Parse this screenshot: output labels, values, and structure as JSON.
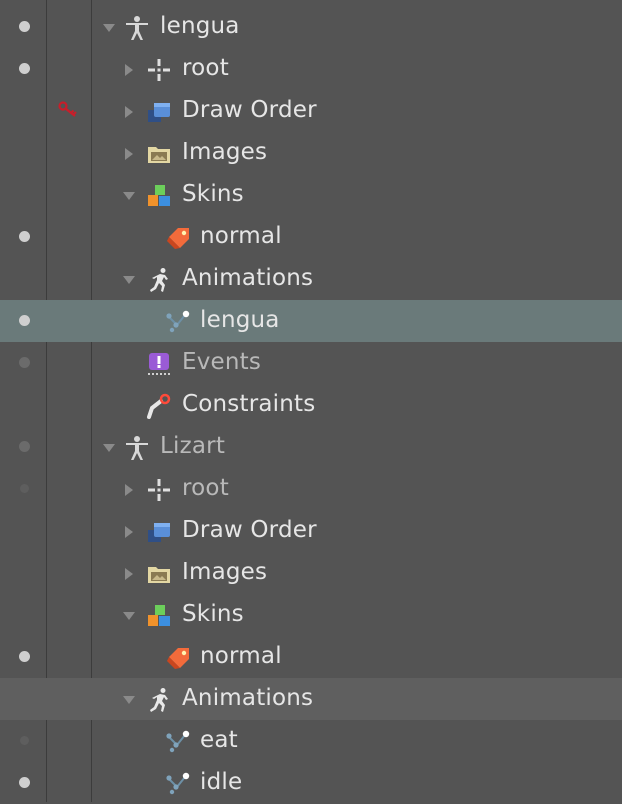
{
  "tree": [
    {
      "label": "lengua",
      "type": "skeleton",
      "depth": 0,
      "expanded": true,
      "visibility": "on"
    },
    {
      "label": "root",
      "type": "bone",
      "depth": 1,
      "expanded": false,
      "visibility": "on"
    },
    {
      "label": "Draw Order",
      "type": "draw-order",
      "depth": 1,
      "expanded": false,
      "visibility": "none",
      "key_icon": true
    },
    {
      "label": "Images",
      "type": "images",
      "depth": 1,
      "expanded": false,
      "visibility": "none"
    },
    {
      "label": "Skins",
      "type": "skins",
      "depth": 1,
      "expanded": true,
      "visibility": "none"
    },
    {
      "label": "normal",
      "type": "skin",
      "depth": 2,
      "expanded": null,
      "visibility": "on"
    },
    {
      "label": "Animations",
      "type": "animations",
      "depth": 1,
      "expanded": true,
      "visibility": "none"
    },
    {
      "label": "lengua",
      "type": "animation",
      "depth": 2,
      "expanded": null,
      "visibility": "on",
      "selected": true
    },
    {
      "label": "Events",
      "type": "events",
      "depth": 1,
      "expanded": null,
      "visibility": "dim"
    },
    {
      "label": "Constraints",
      "type": "constraints",
      "depth": 1,
      "expanded": null,
      "visibility": "none"
    },
    {
      "label": "Lizart",
      "type": "skeleton",
      "depth": 0,
      "expanded": true,
      "visibility": "dim"
    },
    {
      "label": "root",
      "type": "bone",
      "depth": 1,
      "expanded": false,
      "visibility": "faint"
    },
    {
      "label": "Draw Order",
      "type": "draw-order",
      "depth": 1,
      "expanded": false,
      "visibility": "none"
    },
    {
      "label": "Images",
      "type": "images",
      "depth": 1,
      "expanded": false,
      "visibility": "none"
    },
    {
      "label": "Skins",
      "type": "skins",
      "depth": 1,
      "expanded": true,
      "visibility": "none"
    },
    {
      "label": "normal",
      "type": "skin",
      "depth": 2,
      "expanded": null,
      "visibility": "on"
    },
    {
      "label": "Animations",
      "type": "animations",
      "depth": 1,
      "expanded": true,
      "visibility": "none",
      "hover": true
    },
    {
      "label": "eat",
      "type": "animation",
      "depth": 2,
      "expanded": null,
      "visibility": "faint"
    },
    {
      "label": "idle",
      "type": "animation",
      "depth": 2,
      "expanded": null,
      "visibility": "on"
    }
  ],
  "colors": {
    "background": "#545454",
    "selected_row": "#6a7a7a",
    "hover_row": "#5f5f5f",
    "text": "#e6e6e6",
    "visibility_dot": "#cfcfcf"
  }
}
